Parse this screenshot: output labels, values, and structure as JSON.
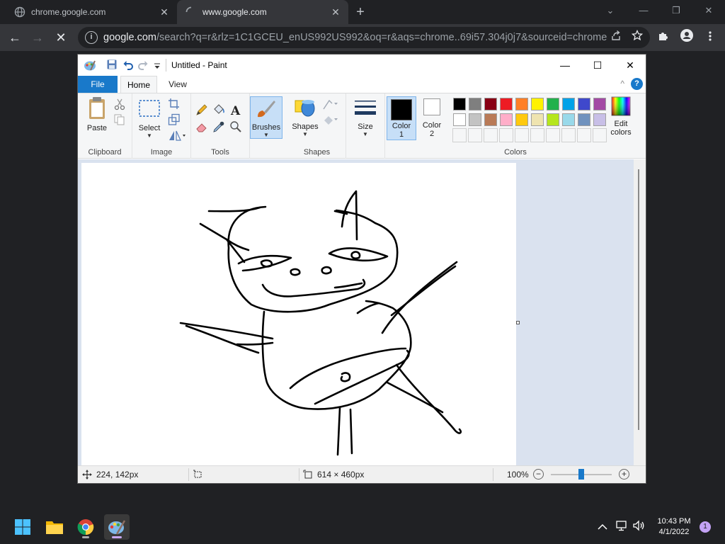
{
  "browser": {
    "tabs": [
      {
        "title": "chrome.google.com",
        "close": "✕"
      },
      {
        "title": "www.google.com",
        "close": "✕"
      }
    ],
    "new_tab": "+",
    "window_controls": {
      "menu": "⌄",
      "minimize": "—",
      "restore": "❐",
      "close": "✕"
    },
    "url_host": "google.com",
    "url_rest": "/search?q=r&rlz=1C1GCEU_enUS992US992&oq=r&aqs=chrome..69i57.304j0j7&sourceid=chrome&...",
    "nav": {
      "back": "←",
      "forward": "→",
      "stop": "✕"
    }
  },
  "paint": {
    "title": "Untitled - Paint",
    "window_controls": {
      "minimize": "—",
      "maximize": "☐",
      "close": "✕"
    },
    "ribbon_tabs": {
      "file": "File",
      "home": "Home",
      "view": "View"
    },
    "help": "?",
    "collapse": "^",
    "groups": {
      "clipboard": {
        "label": "Clipboard",
        "paste": "Paste"
      },
      "image": {
        "label": "Image",
        "select": "Select"
      },
      "tools": {
        "label": "Tools"
      },
      "brushes": {
        "label": "Brushes"
      },
      "shapes": {
        "label": "Shapes",
        "shapes_btn": "Shapes"
      },
      "size": {
        "label": "Size"
      },
      "colors": {
        "label": "Colors",
        "color1_line1": "Color",
        "color1_line2": "1",
        "color2_line1": "Color",
        "color2_line2": "2",
        "edit_line1": "Edit",
        "edit_line2": "colors",
        "palette_row1": [
          "#000000",
          "#7f7f7f",
          "#880015",
          "#ed1c24",
          "#ff7f27",
          "#fff200",
          "#22b14c",
          "#00a2e8",
          "#3f48cc",
          "#a349a4"
        ],
        "palette_row2": [
          "#ffffff",
          "#c3c3c3",
          "#b97a57",
          "#ffaec9",
          "#ffc90e",
          "#efe4b0",
          "#b5e61d",
          "#99d9ea",
          "#7092be",
          "#c8bfe7"
        ],
        "color1": "#000000",
        "color2": "#ffffff"
      }
    },
    "status": {
      "cursor_pos": "224, 142px",
      "image_size": "614 × 460px",
      "zoom": "100%"
    }
  },
  "taskbar": {
    "time": "10:43 PM",
    "date": "4/1/2022",
    "notifications": "1"
  }
}
